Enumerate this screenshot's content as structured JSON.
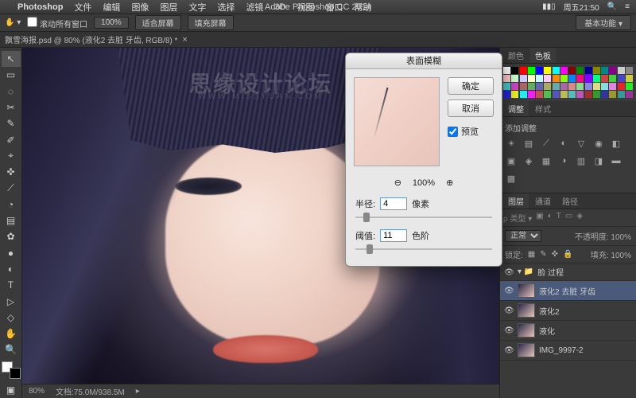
{
  "menubar": {
    "apple": "",
    "items": [
      "Photoshop",
      "文件",
      "编辑",
      "图像",
      "图层",
      "文字",
      "选择",
      "滤镜",
      "3D",
      "视图",
      "窗口",
      "帮助"
    ],
    "time": "周五21:50",
    "battery": "▮▮▯"
  },
  "app_title": "Adobe Photoshop CC 2014",
  "options": {
    "scroll_checkbox": "滚动所有窗口",
    "zoom": "100%",
    "fit": "适合屏幕",
    "fill": "填充屏幕",
    "basic": "基本功能 ▾"
  },
  "tab": {
    "label": "飘雪海报.psd @ 80% (液化2 去脏 牙齿, RGB/8) *"
  },
  "tools": [
    "↖",
    "▭",
    "◌",
    "✂",
    "✎",
    "✐",
    "⌖",
    "✜",
    "⟋",
    "◔",
    "▤",
    "✿",
    "●",
    "◐",
    "△",
    "✒",
    "T",
    "▷",
    "◇",
    "✋",
    "🔍"
  ],
  "watermark": {
    "line1": "思缘设计论坛",
    "line2": "WWW.MISSYUAN.COM"
  },
  "dialog": {
    "title": "表面模糊",
    "ok": "确定",
    "cancel": "取消",
    "preview_label": "预览",
    "preview_checked": true,
    "zoom_minus": "⊖",
    "zoom_pct": "100%",
    "zoom_plus": "⊕",
    "radius_label": "半径:",
    "radius_value": "4",
    "radius_unit": "像素",
    "thresh_label": "阈值:",
    "thresh_value": "11",
    "thresh_unit": "色阶"
  },
  "panels": {
    "swatch_tabs": [
      "颜色",
      "色板"
    ],
    "adjust_tabs": [
      "调整",
      "样式"
    ],
    "adjust_label": "添加调整",
    "layer_tabs": [
      "图层",
      "通道",
      "路径"
    ],
    "blend": "正常",
    "opacity_label": "不透明度:",
    "opacity": "100%",
    "lock_label": "锁定:",
    "fill_label": "填充:",
    "fill": "100%",
    "folder": "脸 过程",
    "layers": [
      {
        "name": "液化2 去脏 牙齿",
        "sel": true
      },
      {
        "name": "液化2"
      },
      {
        "name": "液化"
      },
      {
        "name": "IMG_9997-2"
      }
    ]
  },
  "status": {
    "zoom": "80%",
    "doc": "文档:75.0M/938.5M"
  }
}
